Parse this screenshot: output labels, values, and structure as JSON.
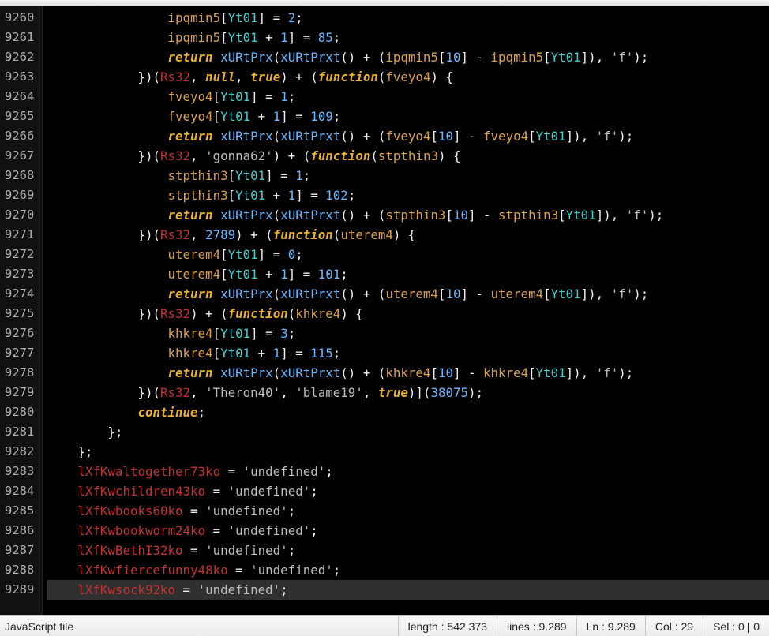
{
  "status": {
    "filetype": "JavaScript file",
    "length_label": "length : ",
    "length_value": "542.373",
    "lines_label": "lines : ",
    "lines_value": "9.289",
    "ln_label": "Ln : ",
    "ln_value": "9.289",
    "col_label": "Col : ",
    "col_value": "29",
    "sel_label": "Sel : ",
    "sel_value": "0 | 0"
  },
  "gutter": {
    "start": 9260,
    "end": 9289
  },
  "code_lines": [
    {
      "indent": 16,
      "tokens": [
        {
          "t": "ident",
          "s": "ipqmin5"
        },
        {
          "t": "punct",
          "s": "["
        },
        {
          "t": "cyanid",
          "s": "Yt01"
        },
        {
          "t": "punct",
          "s": "] = "
        },
        {
          "t": "num",
          "s": "2"
        },
        {
          "t": "punct",
          "s": ";"
        }
      ]
    },
    {
      "indent": 16,
      "tokens": [
        {
          "t": "ident",
          "s": "ipqmin5"
        },
        {
          "t": "punct",
          "s": "["
        },
        {
          "t": "cyanid",
          "s": "Yt01"
        },
        {
          "t": "punct",
          "s": " + "
        },
        {
          "t": "num",
          "s": "1"
        },
        {
          "t": "punct",
          "s": "] = "
        },
        {
          "t": "num",
          "s": "85"
        },
        {
          "t": "punct",
          "s": ";"
        }
      ]
    },
    {
      "indent": 16,
      "tokens": [
        {
          "t": "kw",
          "s": "return"
        },
        {
          "t": "punct",
          "s": " "
        },
        {
          "t": "func",
          "s": "xURtPrx"
        },
        {
          "t": "punct",
          "s": "("
        },
        {
          "t": "func",
          "s": "xURtPrxt"
        },
        {
          "t": "punct",
          "s": "() + ("
        },
        {
          "t": "ident",
          "s": "ipqmin5"
        },
        {
          "t": "punct",
          "s": "["
        },
        {
          "t": "num",
          "s": "10"
        },
        {
          "t": "punct",
          "s": "] - "
        },
        {
          "t": "ident",
          "s": "ipqmin5"
        },
        {
          "t": "punct",
          "s": "["
        },
        {
          "t": "cyanid",
          "s": "Yt01"
        },
        {
          "t": "punct",
          "s": "]), "
        },
        {
          "t": "str",
          "s": "'f'"
        },
        {
          "t": "punct",
          "s": ");"
        }
      ]
    },
    {
      "indent": 12,
      "tokens": [
        {
          "t": "punct",
          "s": "})("
        },
        {
          "t": "global",
          "s": "Rs32"
        },
        {
          "t": "punct",
          "s": ", "
        },
        {
          "t": "kw",
          "s": "null"
        },
        {
          "t": "punct",
          "s": ", "
        },
        {
          "t": "kw",
          "s": "true"
        },
        {
          "t": "punct",
          "s": ") + ("
        },
        {
          "t": "fnword",
          "s": "function"
        },
        {
          "t": "punct",
          "s": "("
        },
        {
          "t": "param",
          "s": "fveyo4"
        },
        {
          "t": "punct",
          "s": ") {"
        }
      ]
    },
    {
      "indent": 16,
      "tokens": [
        {
          "t": "ident",
          "s": "fveyo4"
        },
        {
          "t": "punct",
          "s": "["
        },
        {
          "t": "cyanid",
          "s": "Yt01"
        },
        {
          "t": "punct",
          "s": "] = "
        },
        {
          "t": "num",
          "s": "1"
        },
        {
          "t": "punct",
          "s": ";"
        }
      ]
    },
    {
      "indent": 16,
      "tokens": [
        {
          "t": "ident",
          "s": "fveyo4"
        },
        {
          "t": "punct",
          "s": "["
        },
        {
          "t": "cyanid",
          "s": "Yt01"
        },
        {
          "t": "punct",
          "s": " + "
        },
        {
          "t": "num",
          "s": "1"
        },
        {
          "t": "punct",
          "s": "] = "
        },
        {
          "t": "num",
          "s": "109"
        },
        {
          "t": "punct",
          "s": ";"
        }
      ]
    },
    {
      "indent": 16,
      "tokens": [
        {
          "t": "kw",
          "s": "return"
        },
        {
          "t": "punct",
          "s": " "
        },
        {
          "t": "func",
          "s": "xURtPrx"
        },
        {
          "t": "punct",
          "s": "("
        },
        {
          "t": "func",
          "s": "xURtPrxt"
        },
        {
          "t": "punct",
          "s": "() + ("
        },
        {
          "t": "ident",
          "s": "fveyo4"
        },
        {
          "t": "punct",
          "s": "["
        },
        {
          "t": "num",
          "s": "10"
        },
        {
          "t": "punct",
          "s": "] - "
        },
        {
          "t": "ident",
          "s": "fveyo4"
        },
        {
          "t": "punct",
          "s": "["
        },
        {
          "t": "cyanid",
          "s": "Yt01"
        },
        {
          "t": "punct",
          "s": "]), "
        },
        {
          "t": "str",
          "s": "'f'"
        },
        {
          "t": "punct",
          "s": ");"
        }
      ]
    },
    {
      "indent": 12,
      "tokens": [
        {
          "t": "punct",
          "s": "})("
        },
        {
          "t": "global",
          "s": "Rs32"
        },
        {
          "t": "punct",
          "s": ", "
        },
        {
          "t": "str",
          "s": "'gonna62'"
        },
        {
          "t": "punct",
          "s": ") + ("
        },
        {
          "t": "fnword",
          "s": "function"
        },
        {
          "t": "punct",
          "s": "("
        },
        {
          "t": "param",
          "s": "stpthin3"
        },
        {
          "t": "punct",
          "s": ") {"
        }
      ]
    },
    {
      "indent": 16,
      "tokens": [
        {
          "t": "ident",
          "s": "stpthin3"
        },
        {
          "t": "punct",
          "s": "["
        },
        {
          "t": "cyanid",
          "s": "Yt01"
        },
        {
          "t": "punct",
          "s": "] = "
        },
        {
          "t": "num",
          "s": "1"
        },
        {
          "t": "punct",
          "s": ";"
        }
      ]
    },
    {
      "indent": 16,
      "tokens": [
        {
          "t": "ident",
          "s": "stpthin3"
        },
        {
          "t": "punct",
          "s": "["
        },
        {
          "t": "cyanid",
          "s": "Yt01"
        },
        {
          "t": "punct",
          "s": " + "
        },
        {
          "t": "num",
          "s": "1"
        },
        {
          "t": "punct",
          "s": "] = "
        },
        {
          "t": "num",
          "s": "102"
        },
        {
          "t": "punct",
          "s": ";"
        }
      ]
    },
    {
      "indent": 16,
      "tokens": [
        {
          "t": "kw",
          "s": "return"
        },
        {
          "t": "punct",
          "s": " "
        },
        {
          "t": "func",
          "s": "xURtPrx"
        },
        {
          "t": "punct",
          "s": "("
        },
        {
          "t": "func",
          "s": "xURtPrxt"
        },
        {
          "t": "punct",
          "s": "() + ("
        },
        {
          "t": "ident",
          "s": "stpthin3"
        },
        {
          "t": "punct",
          "s": "["
        },
        {
          "t": "num",
          "s": "10"
        },
        {
          "t": "punct",
          "s": "] - "
        },
        {
          "t": "ident",
          "s": "stpthin3"
        },
        {
          "t": "punct",
          "s": "["
        },
        {
          "t": "cyanid",
          "s": "Yt01"
        },
        {
          "t": "punct",
          "s": "]), "
        },
        {
          "t": "str",
          "s": "'f'"
        },
        {
          "t": "punct",
          "s": ");"
        }
      ]
    },
    {
      "indent": 12,
      "tokens": [
        {
          "t": "punct",
          "s": "})("
        },
        {
          "t": "global",
          "s": "Rs32"
        },
        {
          "t": "punct",
          "s": ", "
        },
        {
          "t": "num",
          "s": "2789"
        },
        {
          "t": "punct",
          "s": ") + ("
        },
        {
          "t": "fnword",
          "s": "function"
        },
        {
          "t": "punct",
          "s": "("
        },
        {
          "t": "param",
          "s": "uterem4"
        },
        {
          "t": "punct",
          "s": ") {"
        }
      ]
    },
    {
      "indent": 16,
      "tokens": [
        {
          "t": "ident",
          "s": "uterem4"
        },
        {
          "t": "punct",
          "s": "["
        },
        {
          "t": "cyanid",
          "s": "Yt01"
        },
        {
          "t": "punct",
          "s": "] = "
        },
        {
          "t": "num",
          "s": "0"
        },
        {
          "t": "punct",
          "s": ";"
        }
      ]
    },
    {
      "indent": 16,
      "tokens": [
        {
          "t": "ident",
          "s": "uterem4"
        },
        {
          "t": "punct",
          "s": "["
        },
        {
          "t": "cyanid",
          "s": "Yt01"
        },
        {
          "t": "punct",
          "s": " + "
        },
        {
          "t": "num",
          "s": "1"
        },
        {
          "t": "punct",
          "s": "] = "
        },
        {
          "t": "num",
          "s": "101"
        },
        {
          "t": "punct",
          "s": ";"
        }
      ]
    },
    {
      "indent": 16,
      "tokens": [
        {
          "t": "kw",
          "s": "return"
        },
        {
          "t": "punct",
          "s": " "
        },
        {
          "t": "func",
          "s": "xURtPrx"
        },
        {
          "t": "punct",
          "s": "("
        },
        {
          "t": "func",
          "s": "xURtPrxt"
        },
        {
          "t": "punct",
          "s": "() + ("
        },
        {
          "t": "ident",
          "s": "uterem4"
        },
        {
          "t": "punct",
          "s": "["
        },
        {
          "t": "num",
          "s": "10"
        },
        {
          "t": "punct",
          "s": "] - "
        },
        {
          "t": "ident",
          "s": "uterem4"
        },
        {
          "t": "punct",
          "s": "["
        },
        {
          "t": "cyanid",
          "s": "Yt01"
        },
        {
          "t": "punct",
          "s": "]), "
        },
        {
          "t": "str",
          "s": "'f'"
        },
        {
          "t": "punct",
          "s": ");"
        }
      ]
    },
    {
      "indent": 12,
      "tokens": [
        {
          "t": "punct",
          "s": "})("
        },
        {
          "t": "global",
          "s": "Rs32"
        },
        {
          "t": "punct",
          "s": ") + ("
        },
        {
          "t": "fnword",
          "s": "function"
        },
        {
          "t": "punct",
          "s": "("
        },
        {
          "t": "param",
          "s": "khkre4"
        },
        {
          "t": "punct",
          "s": ") {"
        }
      ]
    },
    {
      "indent": 16,
      "tokens": [
        {
          "t": "ident",
          "s": "khkre4"
        },
        {
          "t": "punct",
          "s": "["
        },
        {
          "t": "cyanid",
          "s": "Yt01"
        },
        {
          "t": "punct",
          "s": "] = "
        },
        {
          "t": "num",
          "s": "3"
        },
        {
          "t": "punct",
          "s": ";"
        }
      ]
    },
    {
      "indent": 16,
      "tokens": [
        {
          "t": "ident",
          "s": "khkre4"
        },
        {
          "t": "punct",
          "s": "["
        },
        {
          "t": "cyanid",
          "s": "Yt01"
        },
        {
          "t": "punct",
          "s": " + "
        },
        {
          "t": "num",
          "s": "1"
        },
        {
          "t": "punct",
          "s": "] = "
        },
        {
          "t": "num",
          "s": "115"
        },
        {
          "t": "punct",
          "s": ";"
        }
      ]
    },
    {
      "indent": 16,
      "tokens": [
        {
          "t": "kw",
          "s": "return"
        },
        {
          "t": "punct",
          "s": " "
        },
        {
          "t": "func",
          "s": "xURtPrx"
        },
        {
          "t": "punct",
          "s": "("
        },
        {
          "t": "func",
          "s": "xURtPrxt"
        },
        {
          "t": "punct",
          "s": "() + ("
        },
        {
          "t": "ident",
          "s": "khkre4"
        },
        {
          "t": "punct",
          "s": "["
        },
        {
          "t": "num",
          "s": "10"
        },
        {
          "t": "punct",
          "s": "] - "
        },
        {
          "t": "ident",
          "s": "khkre4"
        },
        {
          "t": "punct",
          "s": "["
        },
        {
          "t": "cyanid",
          "s": "Yt01"
        },
        {
          "t": "punct",
          "s": "]), "
        },
        {
          "t": "str",
          "s": "'f'"
        },
        {
          "t": "punct",
          "s": ");"
        }
      ]
    },
    {
      "indent": 12,
      "tokens": [
        {
          "t": "punct",
          "s": "})("
        },
        {
          "t": "global",
          "s": "Rs32"
        },
        {
          "t": "punct",
          "s": ", "
        },
        {
          "t": "str",
          "s": "'Theron40'"
        },
        {
          "t": "punct",
          "s": ", "
        },
        {
          "t": "str",
          "s": "'blame19'"
        },
        {
          "t": "punct",
          "s": ", "
        },
        {
          "t": "kw",
          "s": "true"
        },
        {
          "t": "punct",
          "s": ")]("
        },
        {
          "t": "num",
          "s": "38075"
        },
        {
          "t": "punct",
          "s": ");"
        }
      ]
    },
    {
      "indent": 12,
      "tokens": [
        {
          "t": "kw",
          "s": "continue"
        },
        {
          "t": "punct",
          "s": ";"
        }
      ]
    },
    {
      "indent": 8,
      "tokens": [
        {
          "t": "punct",
          "s": "};"
        }
      ]
    },
    {
      "indent": 4,
      "tokens": [
        {
          "t": "punct",
          "s": "};"
        }
      ]
    },
    {
      "indent": 4,
      "tokens": [
        {
          "t": "global",
          "s": "lXfKwaltogether73ko"
        },
        {
          "t": "punct",
          "s": " = "
        },
        {
          "t": "str",
          "s": "'undefined'"
        },
        {
          "t": "punct",
          "s": ";"
        }
      ]
    },
    {
      "indent": 4,
      "tokens": [
        {
          "t": "global",
          "s": "lXfKwchildren43ko"
        },
        {
          "t": "punct",
          "s": " = "
        },
        {
          "t": "str",
          "s": "'undefined'"
        },
        {
          "t": "punct",
          "s": ";"
        }
      ]
    },
    {
      "indent": 4,
      "tokens": [
        {
          "t": "global",
          "s": "lXfKwbooks60ko"
        },
        {
          "t": "punct",
          "s": " = "
        },
        {
          "t": "str",
          "s": "'undefined'"
        },
        {
          "t": "punct",
          "s": ";"
        }
      ]
    },
    {
      "indent": 4,
      "tokens": [
        {
          "t": "global",
          "s": "lXfKwbookworm24ko"
        },
        {
          "t": "punct",
          "s": " = "
        },
        {
          "t": "str",
          "s": "'undefined'"
        },
        {
          "t": "punct",
          "s": ";"
        }
      ]
    },
    {
      "indent": 4,
      "tokens": [
        {
          "t": "global",
          "s": "lXfKwBethI32ko"
        },
        {
          "t": "punct",
          "s": " = "
        },
        {
          "t": "str",
          "s": "'undefined'"
        },
        {
          "t": "punct",
          "s": ";"
        }
      ]
    },
    {
      "indent": 4,
      "tokens": [
        {
          "t": "global",
          "s": "lXfKwfiercefunny48ko"
        },
        {
          "t": "punct",
          "s": " = "
        },
        {
          "t": "str",
          "s": "'undefined'"
        },
        {
          "t": "punct",
          "s": ";"
        }
      ]
    },
    {
      "indent": 4,
      "cur": true,
      "tokens": [
        {
          "t": "global",
          "s": "lXfKwsock92ko"
        },
        {
          "t": "punct",
          "s": " = "
        },
        {
          "t": "str",
          "s": "'undefined'"
        },
        {
          "t": "punct",
          "s": ";"
        }
      ]
    }
  ]
}
